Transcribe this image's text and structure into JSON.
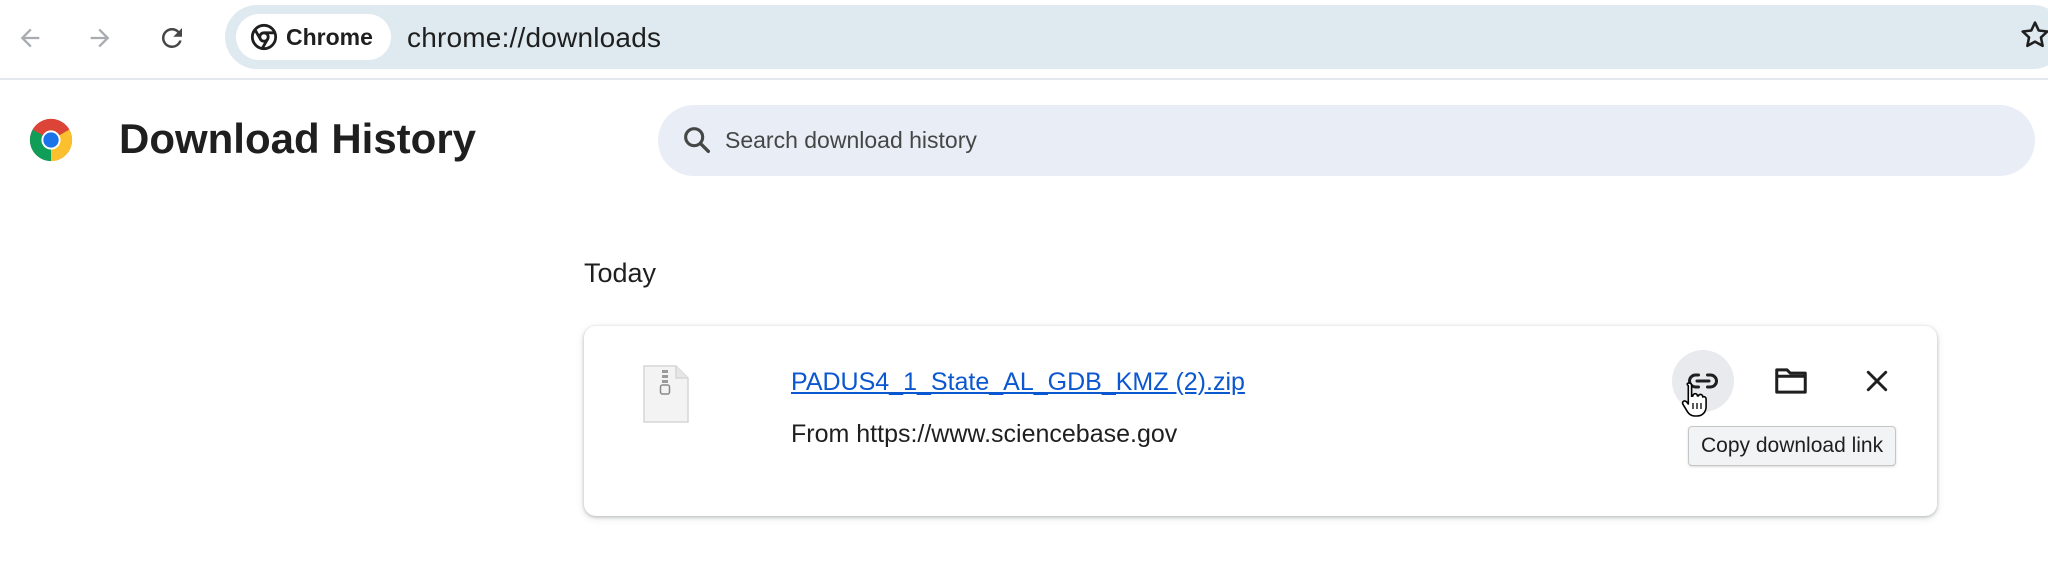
{
  "browser": {
    "chip_label": "Chrome",
    "url": "chrome://downloads"
  },
  "page": {
    "title": "Download History",
    "search_placeholder": "Search download history"
  },
  "downloads": {
    "section_label": "Today",
    "items": [
      {
        "filename": "PADUS4_1_State_AL_GDB_KMZ (2).zip",
        "source": "From https://www.sciencebase.gov",
        "file_type_icon": "zip-file-icon"
      }
    ],
    "actions": {
      "copy_link_icon": "link-icon",
      "show_in_folder_icon": "folder-icon",
      "remove_icon": "close-icon"
    },
    "tooltip": "Copy download link"
  },
  "colors": {
    "link": "#0b57d0",
    "omnibox": "#dfeaf0",
    "search_bg": "#e9eef6"
  }
}
